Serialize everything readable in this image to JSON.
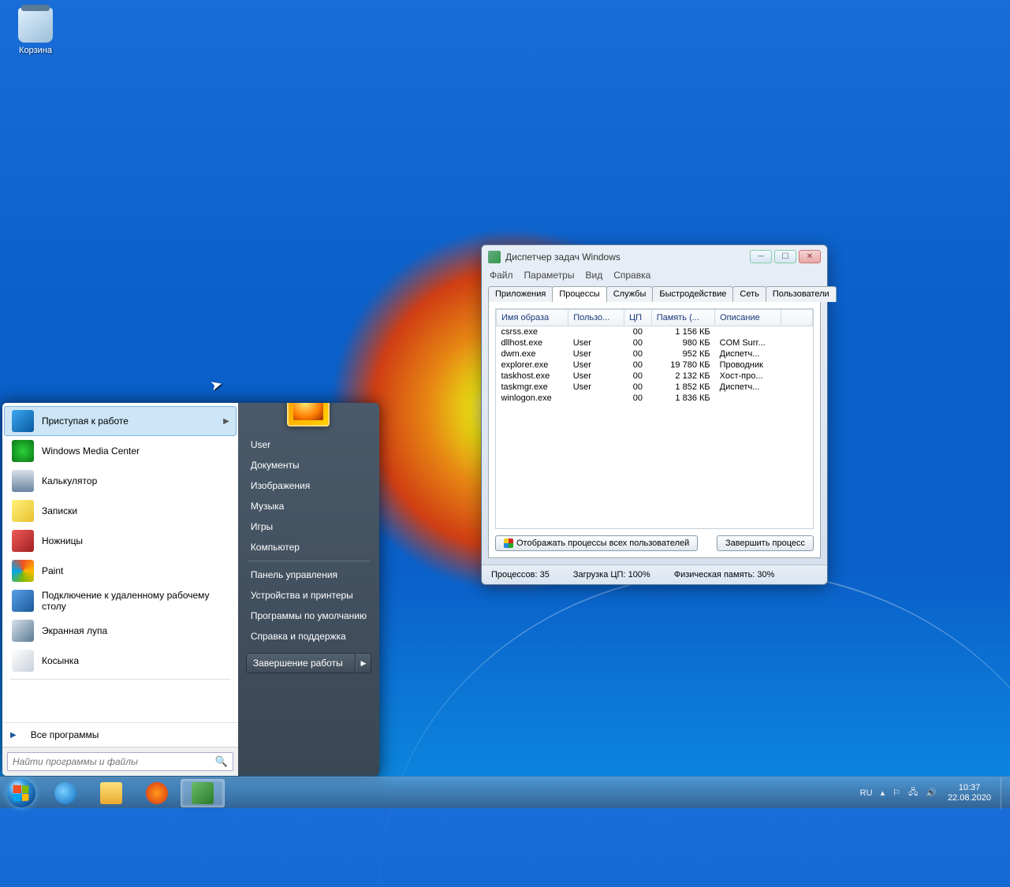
{
  "desktop": {
    "recycle_bin": "Корзина"
  },
  "start_menu": {
    "programs": [
      {
        "label": "Приступая к работе",
        "icon_bg": "linear-gradient(135deg,#3aa8f0,#0a5aa0)",
        "arrow": true,
        "hl": true
      },
      {
        "label": "Windows Media Center",
        "icon_bg": "radial-gradient(circle,#2dd038,#0a7818)"
      },
      {
        "label": "Калькулятор",
        "icon_bg": "linear-gradient(180deg,#d8e0ea,#6a84a0)"
      },
      {
        "label": "Записки",
        "icon_bg": "linear-gradient(135deg,#fff27a,#e8c030)"
      },
      {
        "label": "Ножницы",
        "icon_bg": "linear-gradient(135deg,#f05a5a,#a02020)"
      },
      {
        "label": "Paint",
        "icon_bg": "conic-gradient(#f05022,#ffb900,#7fba00,#00a4ef,#f05022)"
      },
      {
        "label": "Подключение к удаленному рабочему столу",
        "icon_bg": "linear-gradient(135deg,#5aa0e8,#1a5a9a)"
      },
      {
        "label": "Экранная лупа",
        "icon_bg": "linear-gradient(135deg,#d8e0ea,#5a7a95)"
      },
      {
        "label": "Косынка",
        "icon_bg": "linear-gradient(135deg,#fff,#c8d0da)"
      }
    ],
    "all_programs": "Все программы",
    "search_placeholder": "Найти программы и файлы",
    "right_links_1": [
      "User",
      "Документы",
      "Изображения",
      "Музыка",
      "Игры",
      "Компьютер"
    ],
    "right_links_2": [
      "Панель управления",
      "Устройства и принтеры",
      "Программы по умолчанию",
      "Справка и поддержка"
    ],
    "shutdown": "Завершение работы"
  },
  "taskmgr": {
    "title": "Диспетчер задач Windows",
    "menu": [
      "Файл",
      "Параметры",
      "Вид",
      "Справка"
    ],
    "tabs": [
      "Приложения",
      "Процессы",
      "Службы",
      "Быстродействие",
      "Сеть",
      "Пользователи"
    ],
    "active_tab": 1,
    "columns": [
      "Имя образа",
      "Пользо...",
      "ЦП",
      "Память (...",
      "Описание"
    ],
    "rows": [
      {
        "name": "csrss.exe",
        "user": "",
        "cpu": "00",
        "mem": "1 156 КБ",
        "desc": ""
      },
      {
        "name": "dllhost.exe",
        "user": "User",
        "cpu": "00",
        "mem": "980 КБ",
        "desc": "COM Surr..."
      },
      {
        "name": "dwm.exe",
        "user": "User",
        "cpu": "00",
        "mem": "952 КБ",
        "desc": "Диспетч..."
      },
      {
        "name": "explorer.exe",
        "user": "User",
        "cpu": "00",
        "mem": "19 780 КБ",
        "desc": "Проводник"
      },
      {
        "name": "taskhost.exe",
        "user": "User",
        "cpu": "00",
        "mem": "2 132 КБ",
        "desc": "Хост-про..."
      },
      {
        "name": "taskmgr.exe",
        "user": "User",
        "cpu": "00",
        "mem": "1 852 КБ",
        "desc": "Диспетч..."
      },
      {
        "name": "winlogon.exe",
        "user": "",
        "cpu": "00",
        "mem": "1 836 КБ",
        "desc": ""
      }
    ],
    "btn_show_all": "Отображать процессы всех пользователей",
    "btn_end": "Завершить процесс",
    "status": {
      "procs": "Процессов: 35",
      "cpu": "Загрузка ЦП: 100%",
      "mem": "Физическая память: 30%"
    }
  },
  "taskbar": {
    "tray_lang": "RU",
    "time": "10:37",
    "date": "22.08.2020"
  }
}
